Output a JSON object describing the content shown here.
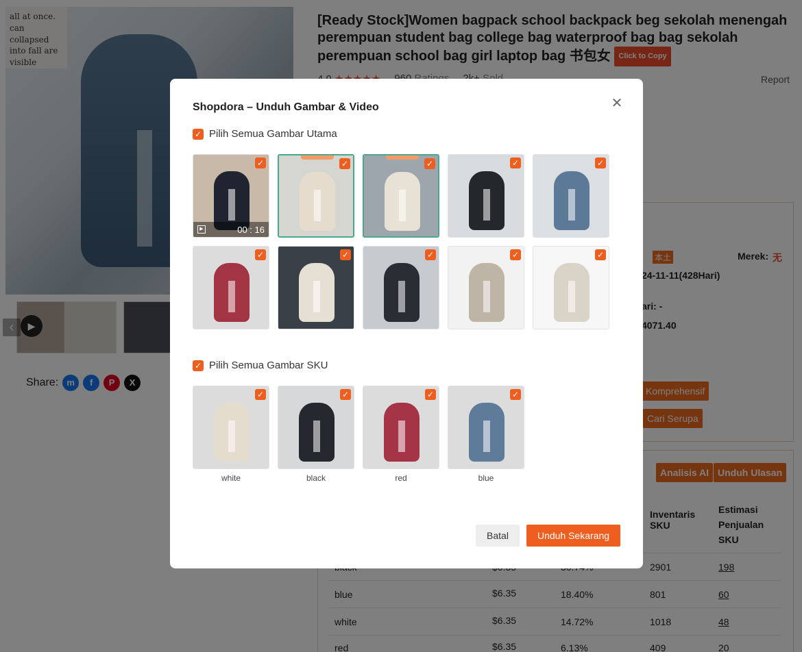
{
  "product": {
    "title": "[Ready Stock]Women bagpack school backpack beg sekolah menengah perempuan student bag college bag waterproof bag bag sekolah perempuan school bag girl laptop bag 书包女",
    "copy_label": "Click to Copy",
    "rating": "4.9",
    "stars": "★★★★★",
    "ratings_count": "960",
    "ratings_label": "Ratings",
    "sold_count": "2k+",
    "sold_label": "Sold",
    "report_label": "Report",
    "share_label": "Share:",
    "note_text": "all at once. can collapsed into fall are visible"
  },
  "panel": {
    "local_badge": "本土",
    "brand_label": "Merek:",
    "brand_value": "无",
    "date_text": "24-11-11(428Hari)",
    "days_text": "ari: -",
    "amount_text": "4071.40",
    "btn_komprehensif": "Komprehensif",
    "btn_cari": "Cari Serupa",
    "btn_analisis": "Analisis AI",
    "btn_unduh_ulasan": "Unduh Ulasan"
  },
  "sku_table": {
    "headers": [
      "Inventaris SKU",
      "Estimasi Penjualan SKU"
    ],
    "rows": [
      {
        "name": "black",
        "price": "$6.35",
        "pct": "30.74%",
        "inv": "2901",
        "sales": "198"
      },
      {
        "name": "blue",
        "price": "$6.35",
        "pct": "18.40%",
        "inv": "801",
        "sales": "60"
      },
      {
        "name": "white",
        "price": "$6.35",
        "pct": "14.72%",
        "inv": "1018",
        "sales": "48"
      },
      {
        "name": "red",
        "price": "$6.35",
        "pct": "6.13%",
        "inv": "409",
        "sales": "20"
      }
    ]
  },
  "modal": {
    "title": "Shopdora – Unduh Gambar & Video",
    "select_main_label": "Pilih Semua Gambar Utama",
    "select_sku_label": "Pilih Semua Gambar SKU",
    "video_duration": "00 : 16",
    "main_images": [
      {
        "name": "main-img-1",
        "color": "#1f2430",
        "bg": "#c9b9a8",
        "video": true
      },
      {
        "name": "main-img-2",
        "color": "#e5dccd",
        "bg": "#d6d6d0",
        "selected": true,
        "badge": true
      },
      {
        "name": "main-img-3",
        "color": "#e8e2d6",
        "bg": "#9ea6ad",
        "selected": true,
        "badge": true
      },
      {
        "name": "main-img-4",
        "color": "#24272c",
        "bg": "#d8dcdf"
      },
      {
        "name": "main-img-5",
        "color": "#5c7a98",
        "bg": "#dcdfe2"
      },
      {
        "name": "main-img-6",
        "color": "#a33444",
        "bg": "#dcdcdc"
      },
      {
        "name": "main-img-7",
        "color": "#e6e0d4",
        "bg": "#3a4048"
      },
      {
        "name": "main-img-8",
        "color": "#2a2d33",
        "bg": "#c7cbd0"
      },
      {
        "name": "main-img-9",
        "color": "#bfb5a7",
        "bg": "#f2f2f2"
      },
      {
        "name": "main-img-10",
        "color": "#d9d3c8",
        "bg": "#f7f7f7"
      }
    ],
    "sku_images": [
      {
        "label": "white",
        "color": "#e4dccd",
        "bg": "#dcdcdc"
      },
      {
        "label": "black",
        "color": "#25282e",
        "bg": "#d6d8da"
      },
      {
        "label": "red",
        "color": "#a63447",
        "bg": "#dcdcdc"
      },
      {
        "label": "blue",
        "color": "#5e7c9a",
        "bg": "#dcdcdc"
      }
    ],
    "cancel_label": "Batal",
    "ok_label": "Unduh Sekarang",
    "close_icon": "close-icon",
    "check_mark": "✓"
  },
  "colors": {
    "accent": "#ee5f1f",
    "selected_border": "#4aa88b"
  }
}
